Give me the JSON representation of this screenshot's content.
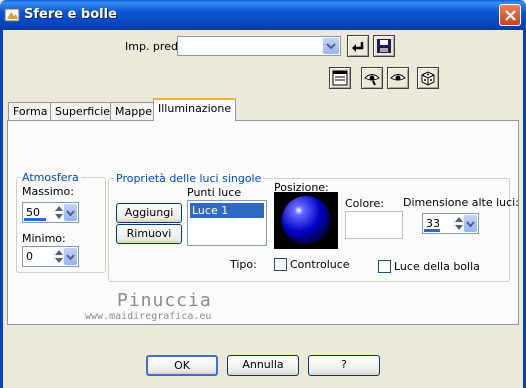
{
  "window": {
    "title": "Sfere e bolle"
  },
  "preset": {
    "label": "Imp. predef.:",
    "value": ""
  },
  "tabs": [
    {
      "label": "Forma"
    },
    {
      "label": "Superficie"
    },
    {
      "label": "Mappe"
    },
    {
      "label": "Illuminazione",
      "active": true
    }
  ],
  "atmosphere": {
    "legend": "Atmosfera",
    "max_label": "Massimo:",
    "max_value": "50",
    "min_label": "Minimo:",
    "min_value": "0"
  },
  "lights": {
    "legend": "Proprietà delle luci singole",
    "list_label": "Punti luce",
    "items": [
      "Luce 1"
    ],
    "add_label": "Aggiungi",
    "remove_label": "Rimuovi",
    "position_label": "Posizione:",
    "color_label": "Colore:",
    "size_label": "Dimensione alte luci:",
    "size_value": "33",
    "type_label": "Tipo:",
    "backlight_label": "Controluce",
    "bubble_light_label": "Luce della bolla"
  },
  "watermark": {
    "name": "Pinuccia",
    "url": "www.maidiregrafica.eu"
  },
  "footer": {
    "ok_label": "OK",
    "cancel_label": "Annulla",
    "help_label": "?"
  },
  "colors": {
    "titlebar": "#0842b8",
    "dialog_bg": "#ece9d8",
    "legend_text": "#0046d5",
    "selection": "#316ac5",
    "sphere": "#0000c8"
  }
}
